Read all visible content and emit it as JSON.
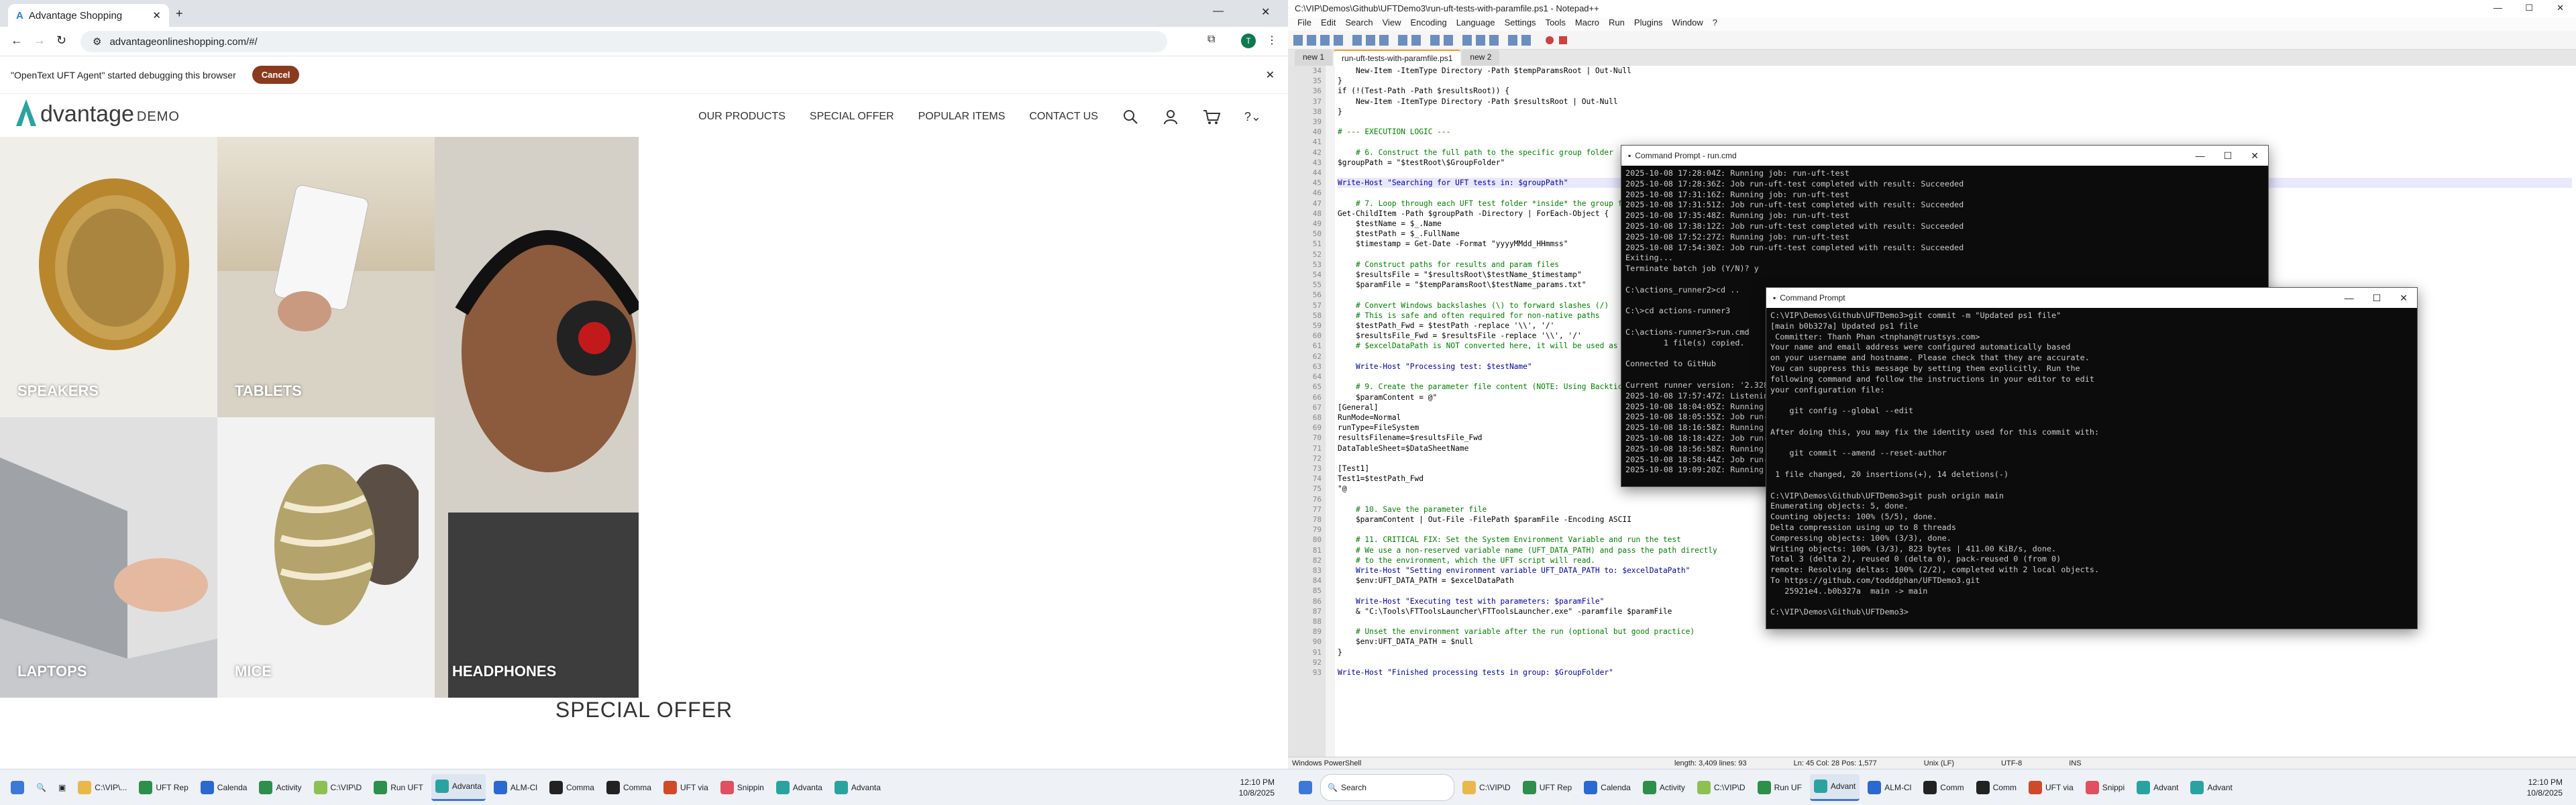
{
  "browser": {
    "tab_title": "Advantage Shopping",
    "url": "advantageonlineshopping.com/#/",
    "debug_msg": "\"OpenText UFT Agent\" started debugging this browser",
    "cancel_label": "Cancel"
  },
  "site": {
    "logo_a": "dvantage",
    "logo_demo": "DEMO",
    "nav": [
      "OUR PRODUCTS",
      "SPECIAL OFFER",
      "POPULAR ITEMS",
      "CONTACT US"
    ],
    "tiles": [
      "SPEAKERS",
      "TABLETS",
      "HEADPHONES",
      "LAPTOPS",
      "MICE"
    ],
    "special_offer": "SPECIAL OFFER"
  },
  "taskbar_left": {
    "items": [
      "C:\\VIP\\...",
      "UFT Rep",
      "Calenda",
      "Activity",
      "C:\\VIP\\D",
      "Run UFT",
      "Advanta",
      "ALM-Cl",
      "Comma",
      "Comma",
      "UFT via",
      "Snippin",
      "Advanta",
      "Advanta"
    ],
    "time": "12:10 PM",
    "date": "10/8/2025"
  },
  "taskbar_right": {
    "search": "Search",
    "items": [
      "C:\\VIP\\D",
      "UFT Rep",
      "Calenda",
      "Activity",
      "C:\\VIP\\D",
      "Run UF",
      "Advant",
      "ALM-Cl",
      "Comm",
      "Comm",
      "UFT via",
      "Snippi",
      "Advant",
      "Advant"
    ],
    "time": "12:10 PM",
    "date": "10/8/2025"
  },
  "npp": {
    "title": "C:\\VIP\\Demos\\Github\\UFTDemo3\\run-uft-tests-with-paramfile.ps1 - Notepad++",
    "menu": [
      "File",
      "Edit",
      "Search",
      "View",
      "Encoding",
      "Language",
      "Settings",
      "Tools",
      "Macro",
      "Run",
      "Plugins",
      "Window",
      "?"
    ],
    "tabs": [
      "new 1",
      "run-uft-tests-with-paramfile.ps1",
      "new 2"
    ],
    "line_start": 34,
    "lines": [
      "    New-Item -ItemType Directory -Path $tempParamsRoot | Out-Null",
      "}",
      "if (!(Test-Path -Path $resultsRoot)) {",
      "    New-Item -ItemType Directory -Path $resultsRoot | Out-Null",
      "}",
      "",
      "# --- EXECUTION LOGIC ---",
      "",
      "    # 6. Construct the full path to the specific group folder",
      "$groupPath = \"$testRoot\\$GroupFolder\"",
      "",
      "Write-Host \"Searching for UFT tests in: $groupPath\"",
      "",
      "    # 7. Loop through each UFT test folder *inside* the group folder",
      "Get-ChildItem -Path $groupPath -Directory | ForEach-Object {",
      "    $testName = $_.Name",
      "    $testPath = $_.FullName",
      "    $timestamp = Get-Date -Format \"yyyyMMdd_HHmmss\"",
      "",
      "    # Construct paths for results and param files",
      "    $resultsFile = \"$resultsRoot\\$testName_$timestamp\"",
      "    $paramFile = \"$tempParamsRoot\\$testName_params.txt\"",
      "",
      "    # Convert Windows backslashes (\\) to forward slashes (/)",
      "    # This is safe and often required for non-native paths",
      "    $testPath_Fwd = $testPath -replace '\\\\', '/'",
      "    $resultsFile_Fwd = $resultsFile -replace '\\\\', '/'",
      "    # $excelDataPath is NOT converted here, it will be used as is",
      "",
      "    Write-Host \"Processing test: $testName\"",
      "",
      "    # 9. Create the parameter file content (NOTE: Using Backtick-N for newline)",
      "    $paramContent = @\"",
      "[General]",
      "RunMode=Normal",
      "runType=FileSystem",
      "resultsFilename=$resultsFile_Fwd",
      "DataTableSheet=$DataSheetName",
      "",
      "[Test1]",
      "Test1=$testPath_Fwd",
      "\"@",
      "",
      "    # 10. Save the parameter file",
      "    $paramContent | Out-File -FilePath $paramFile -Encoding ASCII",
      "",
      "    # 11. CRITICAL FIX: Set the System Environment Variable and run the test",
      "    # We use a non-reserved variable name (UFT_DATA_PATH) and pass the path directly",
      "    # to the environment, which the UFT script will read.",
      "    Write-Host \"Setting environment variable UFT_DATA_PATH to: $excelDataPath\"",
      "    $env:UFT_DATA_PATH = $excelDataPath",
      "",
      "    Write-Host \"Executing test with parameters: $paramFile\"",
      "    & \"C:\\Tools\\FTToolsLauncher\\FTToolsLauncher.exe\" -paramfile $paramFile",
      "",
      "    # Unset the environment variable after the run (optional but good practice)",
      "    $env:UFT_DATA_PATH = $null",
      "}",
      "",
      "Write-Host \"Finished processing tests in group: $GroupFolder\""
    ],
    "status_left": "Windows PowerShell",
    "status_len": "length: 3,409    lines: 93",
    "status_pos": "Ln: 45    Col: 28    Pos: 1,577",
    "status_eol": "Unix (LF)",
    "status_enc": "UTF-8",
    "status_ins": "INS"
  },
  "cmd1": {
    "title": "Command Prompt - run.cmd",
    "lines": [
      "2025-10-08 17:28:04Z: Running job: run-uft-test",
      "2025-10-08 17:28:36Z: Job run-uft-test completed with result: Succeeded",
      "2025-10-08 17:31:16Z: Running job: run-uft-test",
      "2025-10-08 17:31:51Z: Job run-uft-test completed with result: Succeeded",
      "2025-10-08 17:35:48Z: Running job: run-uft-test",
      "2025-10-08 17:38:12Z: Job run-uft-test completed with result: Succeeded",
      "2025-10-08 17:52:27Z: Running job: run-uft-test",
      "2025-10-08 17:54:30Z: Job run-uft-test completed with result: Succeeded",
      "Exiting...",
      "Terminate batch job (Y/N)? y",
      "",
      "C:\\actions_runner2>cd ..",
      "",
      "C:\\>cd actions-runner3",
      "",
      "C:\\actions-runner3>run.cmd",
      "        1 file(s) copied.",
      "",
      "Connected to GitHub",
      "",
      "Current runner version: '2.328.0'",
      "2025-10-08 17:57:47Z: Listening for Jobs",
      "2025-10-08 18:04:05Z: Running job: run-uft-test",
      "2025-10-08 18:05:55Z: Job run-uft-test completed with result: Succeeded",
      "2025-10-08 18:16:58Z: Running job: run-uft-test",
      "2025-10-08 18:18:42Z: Job run-uft-test completed with result: Succeeded",
      "2025-10-08 18:56:58Z: Running job: run-uft-test",
      "2025-10-08 18:58:44Z: Job run-uft-test completed with result: Succeeded",
      "2025-10-08 19:09:20Z: Running job: run-uft-test"
    ]
  },
  "cmd2": {
    "title": "Command Prompt",
    "lines": [
      "C:\\VIP\\Demos\\Github\\UFTDemo3>git commit -m \"Updated ps1 file\"",
      "[main b0b327a] Updated ps1 file",
      " Committer: Thanh Phan <tnphan@trustsys.com>",
      "Your name and email address were configured automatically based",
      "on your username and hostname. Please check that they are accurate.",
      "You can suppress this message by setting them explicitly. Run the",
      "following command and follow the instructions in your editor to edit",
      "your configuration file:",
      "",
      "    git config --global --edit",
      "",
      "After doing this, you may fix the identity used for this commit with:",
      "",
      "    git commit --amend --reset-author",
      "",
      " 1 file changed, 20 insertions(+), 14 deletions(-)",
      "",
      "C:\\VIP\\Demos\\Github\\UFTDemo3>git push origin main",
      "Enumerating objects: 5, done.",
      "Counting objects: 100% (5/5), done.",
      "Delta compression using up to 8 threads",
      "Compressing objects: 100% (3/3), done.",
      "Writing objects: 100% (3/3), 823 bytes | 411.00 KiB/s, done.",
      "Total 3 (delta 2), reused 0 (delta 0), pack-reused 0 (from 0)",
      "remote: Resolving deltas: 100% (2/2), completed with 2 local objects.",
      "To https://github.com/todddphan/UFTDemo3.git",
      "   25921e4..b0b327a  main -> main",
      "",
      "C:\\VIP\\Demos\\Github\\UFTDemo3>"
    ]
  }
}
